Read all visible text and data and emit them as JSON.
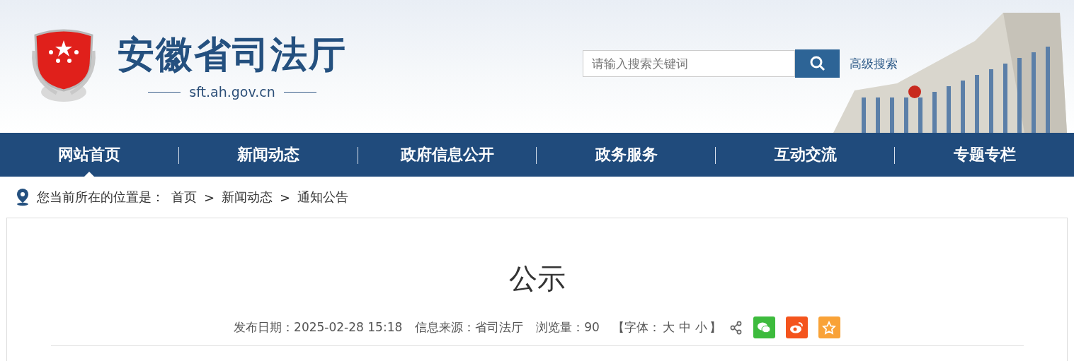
{
  "header": {
    "site_name": "安徽省司法厅",
    "domain": "sft.ah.gov.cn",
    "search": {
      "placeholder": "请输入搜索关键词"
    },
    "advanced_search": "高级搜索"
  },
  "nav": [
    {
      "label": "网站首页",
      "selected": true
    },
    {
      "label": "新闻动态",
      "selected": false
    },
    {
      "label": "政府信息公开",
      "selected": false
    },
    {
      "label": "政务服务",
      "selected": false
    },
    {
      "label": "互动交流",
      "selected": false
    },
    {
      "label": "专题专栏",
      "selected": false
    }
  ],
  "breadcrumb": {
    "prefix": "您当前所在的位置是：",
    "items": [
      "首页",
      "新闻动态",
      "通知公告"
    ],
    "separator": ">"
  },
  "article": {
    "title": "公示",
    "meta": [
      {
        "label": "发布日期：",
        "value": "2025-02-28 15:18"
      },
      {
        "label": "信息来源：",
        "value": "省司法厅"
      },
      {
        "label": "浏览量：",
        "value": "90"
      }
    ],
    "font_size": {
      "open": "【字体：",
      "sizes": [
        "大",
        "中",
        "小"
      ],
      "close": "】"
    },
    "share": [
      {
        "kind": "wechat",
        "color": "#3dbb3d"
      },
      {
        "kind": "weibo",
        "color": "#f4541d"
      },
      {
        "kind": "favorite",
        "color": "#f9a237"
      }
    ]
  }
}
